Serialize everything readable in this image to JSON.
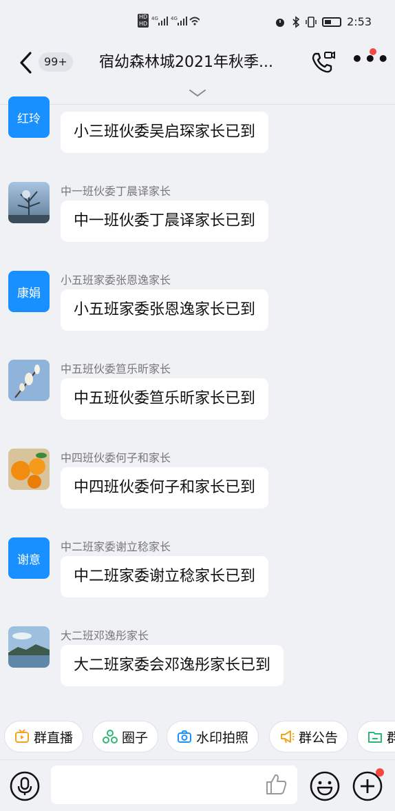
{
  "status_bar": {
    "network": "HD 4G 4G",
    "time": "2:53"
  },
  "header": {
    "back_count": "99+",
    "title": "宿幼森林城2021年秋季..."
  },
  "messages": [
    {
      "avatar_text": "红玲",
      "sender": "",
      "text": "小三班伙委吴启琛家长已到"
    },
    {
      "avatar_text": "",
      "avatar_icon": "winter-tree-photo",
      "sender": "中一班伙委丁晨译家长",
      "text": "中一班伙委丁晨译家长已到"
    },
    {
      "avatar_text": "康娟",
      "sender": "小五班家委张恩逸家长",
      "text": "小五班家委张恩逸家长已到"
    },
    {
      "avatar_text": "",
      "avatar_icon": "magnolia-photo",
      "sender": "中五班伙委笪乐昕家长",
      "text": "中五班伙委笪乐昕家长已到"
    },
    {
      "avatar_text": "",
      "avatar_icon": "oranges-photo",
      "sender": "中四班伙委何子和家长",
      "text": "中四班伙委何子和家长已到"
    },
    {
      "avatar_text": "谢意",
      "sender": "中二班家委谢立稔家长",
      "text": "中二班家委谢立稔家长已到"
    },
    {
      "avatar_text": "",
      "avatar_icon": "lake-landscape-photo",
      "sender": "大二班邓逸彤家长",
      "text": "大二班家委会邓逸彤家长已到"
    }
  ],
  "quick_actions": [
    {
      "label": "群直播",
      "icon": "live-tv-icon",
      "color": "#f7a21b"
    },
    {
      "label": "圈子",
      "icon": "circle-group-icon",
      "color": "#2bb673"
    },
    {
      "label": "水印拍照",
      "icon": "camera-icon",
      "color": "#1890ff"
    },
    {
      "label": "群公告",
      "icon": "megaphone-icon",
      "color": "#f7a21b"
    },
    {
      "label": "群",
      "icon": "folder-icon",
      "color": "#2bb673"
    }
  ],
  "colors": {
    "accent": "#1890ff",
    "notification": "#f4493e",
    "background": "#f0f1f5"
  }
}
